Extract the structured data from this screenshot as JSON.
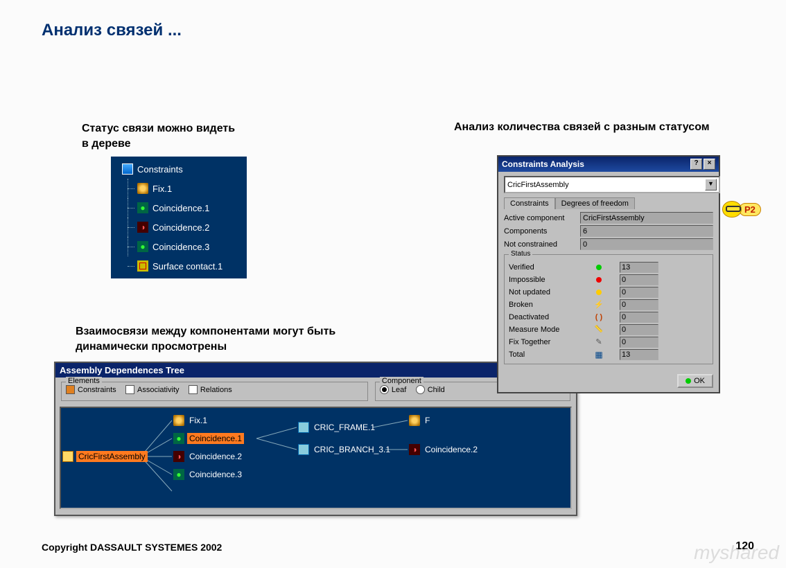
{
  "slide": {
    "title": "Анализ связей ...",
    "caption_tree": "Статус связи можно видеть\nв дереве",
    "caption_analysis": "Анализ количества связей с разным статусом",
    "caption_dep": "Взаимосвязи между компонентами могут быть динамически просмотрены",
    "copyright": "Copyright DASSAULT SYSTEMES 2002",
    "page_number": "120",
    "watermark": "myshared"
  },
  "tree": {
    "root": "Constraints",
    "items": [
      "Fix.1",
      "Coincidence.1",
      "Coincidence.2",
      "Coincidence.3",
      "Surface contact.1"
    ]
  },
  "dep_window": {
    "title": "Assembly Dependences Tree",
    "elements_legend": "Elements",
    "component_legend": "Component",
    "chk_constraints": "Constraints",
    "chk_associativity": "Associativity",
    "chk_relations": "Relations",
    "rad_leaf": "Leaf",
    "rad_child": "Child",
    "root_node": "CricFirstAssembly",
    "nodes": {
      "fix": "Fix.1",
      "coin1": "Coincidence.1",
      "coin2": "Coincidence.2",
      "coin3": "Coincidence.3",
      "frame": "CRIC_FRAME.1",
      "branch": "CRIC_BRANCH_3.1",
      "coin2b": "Coincidence.2",
      "f_trunc": "F"
    }
  },
  "analysis": {
    "title": "Constraints Analysis",
    "help_btn": "?",
    "close_btn": "×",
    "dropdown_value": "CricFirstAssembly",
    "tab_constraints": "Constraints",
    "tab_dof": "Degrees of freedom",
    "meta": {
      "active_label": "Active component",
      "active_value": "CricFirstAssembly",
      "components_label": "Components",
      "components_value": "6",
      "notcon_label": "Not constrained",
      "notcon_value": "0"
    },
    "status_legend": "Status",
    "status_rows": [
      {
        "label": "Verified",
        "value": "13",
        "icon": "led-green"
      },
      {
        "label": "Impossible",
        "value": "0",
        "icon": "led-red"
      },
      {
        "label": "Not updated",
        "value": "0",
        "icon": "led-yellow"
      },
      {
        "label": "Broken",
        "value": "0",
        "icon": "broken"
      },
      {
        "label": "Deactivated",
        "value": "0",
        "icon": "deact"
      },
      {
        "label": "Measure Mode",
        "value": "0",
        "icon": "meas"
      },
      {
        "label": "Fix Together",
        "value": "0",
        "icon": "ft"
      },
      {
        "label": "Total",
        "value": "13",
        "icon": "total"
      }
    ],
    "ok_label": "OK"
  },
  "p2_badge": "P2"
}
